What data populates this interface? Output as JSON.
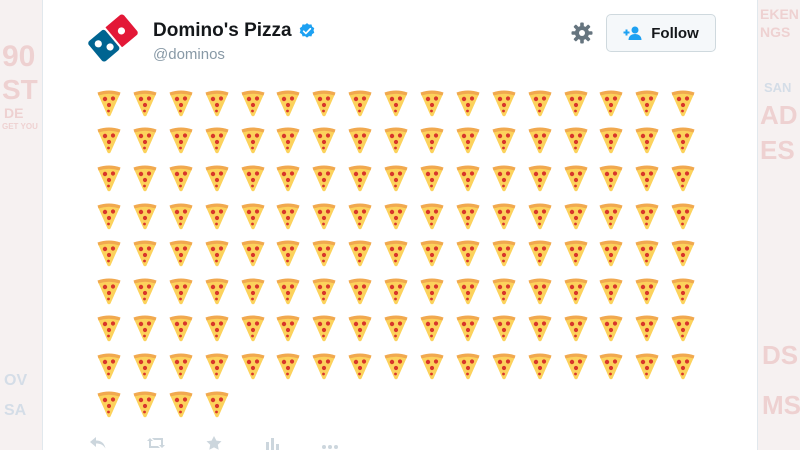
{
  "tweet": {
    "display_name": "Domino's Pizza",
    "handle": "@dominos",
    "verified": true,
    "follow_label": "Follow",
    "emoji": "pizza-slice",
    "emoji_count": 140,
    "emoji_rows": 9,
    "emoji_per_row": 17
  },
  "colors": {
    "brand_blue": "#006491",
    "brand_red": "#e31837",
    "verified_blue": "#1da1f2",
    "crust": "#f1a94f",
    "cheese": "#fcd25c",
    "pepperoni": "#d8362b"
  },
  "background_poster_text": [
    "90",
    "ST",
    "DE",
    "GET YOU",
    "OV",
    "SA",
    "EKEN",
    "NGS",
    "SAN",
    "AD",
    "ES",
    "DS",
    "MS"
  ]
}
